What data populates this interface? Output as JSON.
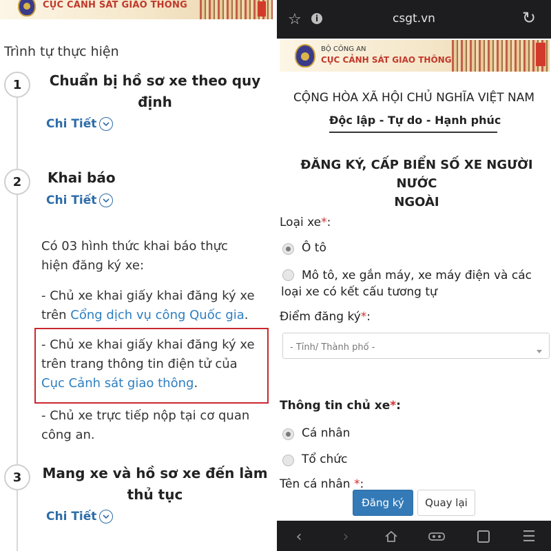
{
  "left": {
    "banner_title": "CỤC CẢNH SÁT GIAO THÔNG",
    "section_title": "Trình tự thực hiện",
    "detail_label": "Chi Tiết",
    "steps": [
      {
        "number": "1",
        "title_line1": "Chuẩn bị hồ sơ xe theo quy",
        "title_line2": "định"
      },
      {
        "number": "2",
        "title_line1": "Khai báo"
      },
      {
        "number": "3",
        "title_line1": "Mang xe và hồ sơ xe đến làm",
        "title_line2": "thủ tục"
      }
    ],
    "declare": {
      "intro_line1": "Có 03 hình thức khai báo thực",
      "intro_line2": "hiện đăng ký xe:",
      "option1_line1": "- Chủ xe khai giấy khai đăng ký xe",
      "option1_prefix": "trên ",
      "option1_link": "Cổng dịch vụ công Quốc gia",
      "option1_suffix": ".",
      "option2_line1": "- Chủ xe khai giấy khai đăng ký xe",
      "option2_line2": "trên trang thông tin điện tử của",
      "option2_link": "Cục Cảnh sát giao thông",
      "option2_suffix": ".",
      "option3_line1": "- Chủ xe trực tiếp nộp tại cơ quan",
      "option3_line2": "công an."
    },
    "highlight_color": "#c9272e",
    "link_color": "#2d7ec0"
  },
  "right": {
    "browser": {
      "url": "csgt.vn"
    },
    "banner": {
      "sub": "BỘ CÔNG AN",
      "main": "CỤC CẢNH SÁT GIAO THÔNG"
    },
    "nation": "CỘNG HÒA XÃ HỘI CHỦ NGHĨA VIỆT NAM",
    "motto": "Độc lập - Tự do - Hạnh phúc",
    "form_title_line1": "ĐĂNG KÝ, CẤP BIỂN SỐ XE NGƯỜI NƯỚC",
    "form_title_line2": "NGOÀI",
    "vehicle_type_label": "Loại xe",
    "vehicle_options": {
      "car": "Ô tô",
      "moto_line1": "Mô tô, xe gắn máy, xe máy điện và các",
      "moto_line2": "loại xe có kết cấu tương tự",
      "selected": "car"
    },
    "reg_point_label": "Điểm đăng ký",
    "reg_point_select": "- Tỉnh/ Thành phố -",
    "owner_label": "Thông tin chủ xe",
    "owner_options": {
      "personal": "Cá nhân",
      "org": "Tổ chức",
      "selected": "personal"
    },
    "personal_name_label": "Tên cá nhân",
    "required_mark": "*",
    "colon": ":",
    "buttons": {
      "register": "Đăng ký",
      "back": "Quay lại"
    },
    "primary_color": "#337ab7"
  }
}
